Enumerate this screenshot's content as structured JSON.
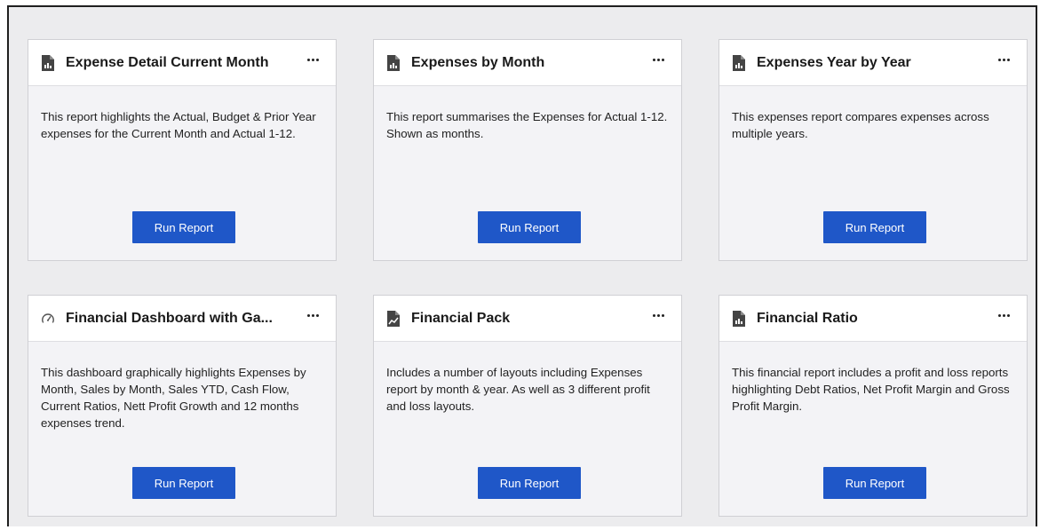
{
  "colors": {
    "accent": "#1f57c8",
    "page_background": "#ececee",
    "card_background": "#f3f3f6",
    "header_background": "#ffffff"
  },
  "cards": [
    {
      "icon": "report-icon",
      "title": "Expense Detail Current Month",
      "description": "This report highlights the Actual, Budget & Prior Year expenses for the Current Month and Actual 1-12.",
      "button_label": "Run Report"
    },
    {
      "icon": "report-icon",
      "title": "Expenses by Month",
      "description": "This report summarises the Expenses for Actual 1-12. Shown as months.",
      "button_label": "Run Report"
    },
    {
      "icon": "report-icon",
      "title": "Expenses Year by Year",
      "description": "This expenses report compares expenses across multiple years.",
      "button_label": "Run Report"
    },
    {
      "icon": "gauge-icon",
      "title": "Financial Dashboard with Ga...",
      "description": "This dashboard graphically highlights Expenses by Month, Sales by Month, Sales YTD, Cash Flow, Current Ratios, Nett Profit Growth and 12 months expenses trend.",
      "button_label": "Run Report"
    },
    {
      "icon": "chart-pack-icon",
      "title": "Financial Pack",
      "description": "Includes a number of layouts including Expenses report by month & year. As well as 3 different profit and loss layouts.",
      "button_label": "Run Report"
    },
    {
      "icon": "report-icon",
      "title": "Financial Ratio",
      "description": "This financial report includes a profit and loss reports highlighting Debt Ratios, Net Profit Margin and Gross Profit Margin.",
      "button_label": "Run Report"
    }
  ]
}
